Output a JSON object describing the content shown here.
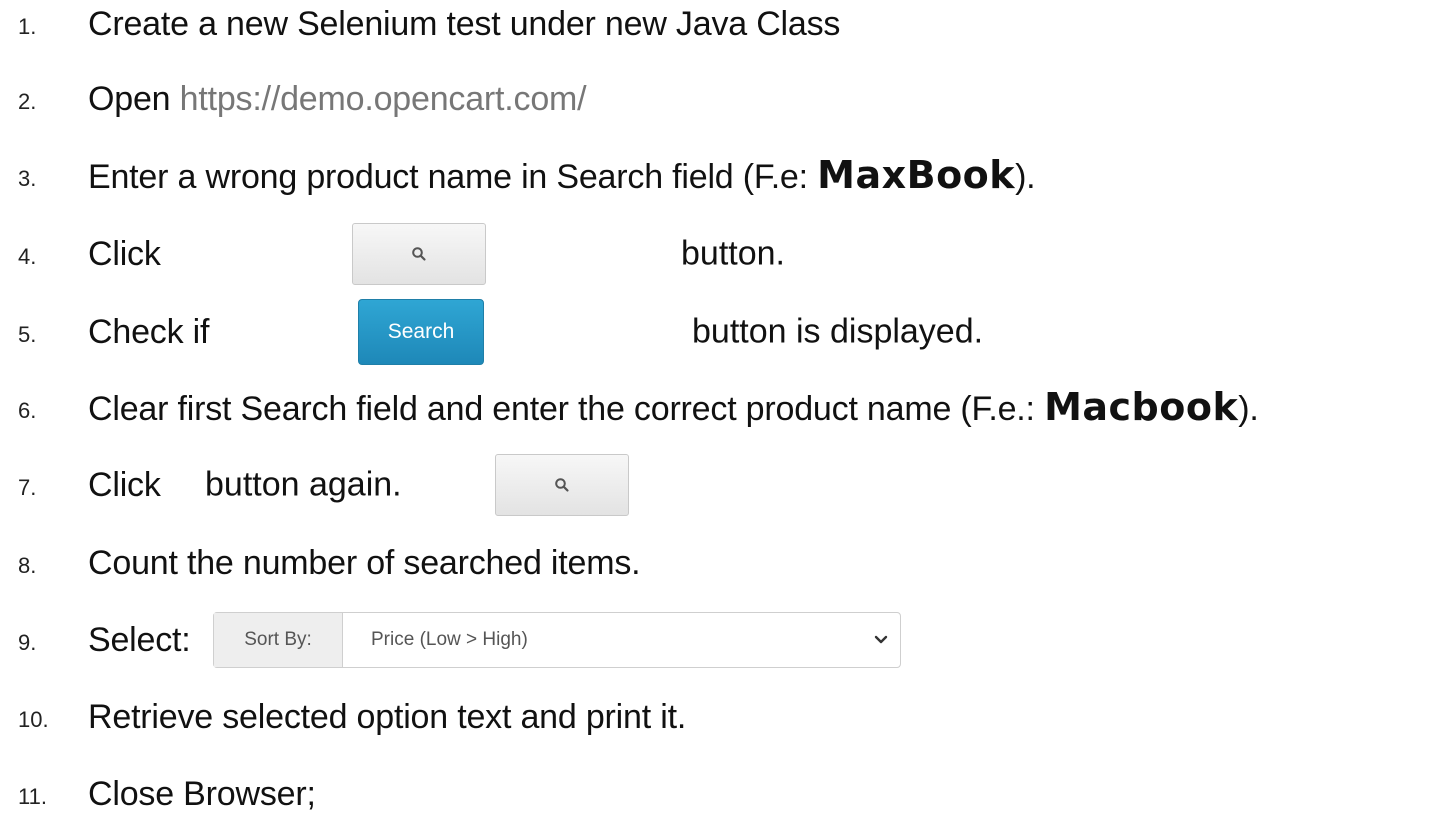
{
  "steps": [
    {
      "num": "1.",
      "text": "Create a new Selenium test under new Java Class"
    },
    {
      "num": "2.",
      "prefix": "Open ",
      "link": "https://demo.opencart.com/"
    },
    {
      "num": "3.",
      "prefix": "Enter a wrong product name in Search field (F.e: ",
      "strong": "MaxBook",
      "suffix": ")."
    },
    {
      "num": "4.",
      "prefix": "Click",
      "suffix": "button."
    },
    {
      "num": "5.",
      "prefix": "Check if",
      "button_label": "Search",
      "suffix": "button is displayed."
    },
    {
      "num": "6.",
      "prefix": "Clear first Search field and enter the correct product name (F.e.: ",
      "strong": "Macbook",
      "suffix": ")."
    },
    {
      "num": "7.",
      "prefix": "Click",
      "suffix": "button again."
    },
    {
      "num": "8.",
      "text": "Count the number of searched items."
    },
    {
      "num": "9.",
      "prefix": "Select:",
      "sort_label": "Sort By:",
      "sort_value": "Price (Low > High)"
    },
    {
      "num": "10.",
      "text": "Retrieve selected option text and print it."
    },
    {
      "num": "11.",
      "text": "Close Browser;"
    }
  ],
  "icons": {
    "search_button_icon": "magnifier-icon",
    "dropdown_icon": "chevron-down-icon"
  }
}
